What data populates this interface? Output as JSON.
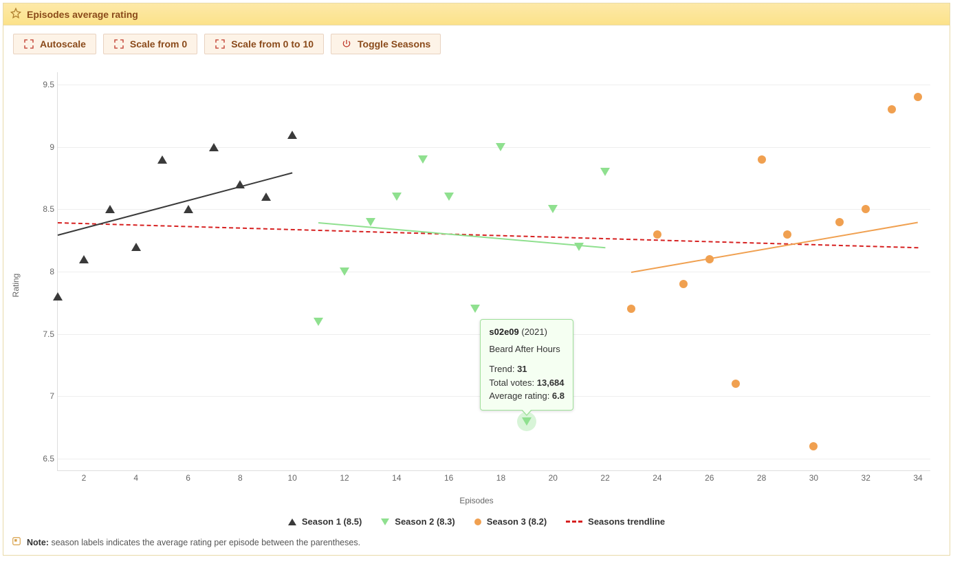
{
  "panel": {
    "title": "Episodes average rating"
  },
  "toolbar": {
    "autoscale": "Autoscale",
    "scale0": "Scale from 0",
    "scale010": "Scale from 0 to 10",
    "toggle": "Toggle Seasons"
  },
  "legend": {
    "s1": "Season 1 (8.5)",
    "s2": "Season 2 (8.3)",
    "s3": "Season 3 (8.2)",
    "trend": "Seasons trendline"
  },
  "note": {
    "label": "Note:",
    "text": "season labels indicates the average rating per episode between the parentheses."
  },
  "tooltip": {
    "code": "s02e09",
    "year": "(2021)",
    "title": "Beard After Hours",
    "trend_label": "Trend:",
    "trend": "31",
    "votes_label": "Total votes:",
    "votes": "13,684",
    "avg_label": "Average rating:",
    "avg": "6.8"
  },
  "chart_data": {
    "type": "scatter",
    "xlabel": "Episodes",
    "ylabel": "Rating",
    "xlim": [
      1,
      34.5
    ],
    "ylim": [
      6.4,
      9.6
    ],
    "xticks": [
      2,
      4,
      6,
      8,
      10,
      12,
      14,
      16,
      18,
      20,
      22,
      24,
      26,
      28,
      30,
      32,
      34
    ],
    "yticks": [
      6.5,
      7,
      7.5,
      8,
      8.5,
      9,
      9.5
    ],
    "series": [
      {
        "name": "Season 1 (8.5)",
        "marker": "triangle-up",
        "color": "#3a3a3a",
        "points": [
          {
            "x": 1,
            "y": 7.8
          },
          {
            "x": 2,
            "y": 8.1
          },
          {
            "x": 3,
            "y": 8.5
          },
          {
            "x": 4,
            "y": 8.2
          },
          {
            "x": 5,
            "y": 8.9
          },
          {
            "x": 6,
            "y": 8.5
          },
          {
            "x": 7,
            "y": 9.0
          },
          {
            "x": 8,
            "y": 8.7
          },
          {
            "x": 9,
            "y": 8.6
          },
          {
            "x": 10,
            "y": 9.1
          }
        ],
        "trend": {
          "x1": 1,
          "y1": 8.3,
          "x2": 10,
          "y2": 8.8
        }
      },
      {
        "name": "Season 2 (8.3)",
        "marker": "triangle-down",
        "color": "#8fe08f",
        "points": [
          {
            "x": 11,
            "y": 7.6
          },
          {
            "x": 12,
            "y": 8.0
          },
          {
            "x": 13,
            "y": 8.4
          },
          {
            "x": 14,
            "y": 8.6
          },
          {
            "x": 15,
            "y": 8.9
          },
          {
            "x": 16,
            "y": 8.6
          },
          {
            "x": 17,
            "y": 7.7
          },
          {
            "x": 18,
            "y": 9.0
          },
          {
            "x": 19,
            "y": 6.8,
            "highlight": true
          },
          {
            "x": 20,
            "y": 8.5
          },
          {
            "x": 21,
            "y": 8.2
          },
          {
            "x": 22,
            "y": 8.8
          }
        ],
        "trend": {
          "x1": 11,
          "y1": 8.4,
          "x2": 22,
          "y2": 8.2
        }
      },
      {
        "name": "Season 3 (8.2)",
        "marker": "circle",
        "color": "#f0a050",
        "points": [
          {
            "x": 23,
            "y": 7.7
          },
          {
            "x": 24,
            "y": 8.3
          },
          {
            "x": 25,
            "y": 7.9
          },
          {
            "x": 26,
            "y": 8.1
          },
          {
            "x": 27,
            "y": 7.1
          },
          {
            "x": 28,
            "y": 8.9
          },
          {
            "x": 29,
            "y": 8.3
          },
          {
            "x": 30,
            "y": 6.6
          },
          {
            "x": 31,
            "y": 8.4
          },
          {
            "x": 32,
            "y": 8.5
          },
          {
            "x": 33,
            "y": 9.3
          },
          {
            "x": 34,
            "y": 9.4
          }
        ],
        "trend": {
          "x1": 23,
          "y1": 8.0,
          "x2": 34,
          "y2": 8.4
        }
      }
    ],
    "overall_trend": {
      "x1": 1,
      "y1": 8.4,
      "x2": 34,
      "y2": 8.2,
      "color": "#d62020",
      "dashed": true
    }
  }
}
